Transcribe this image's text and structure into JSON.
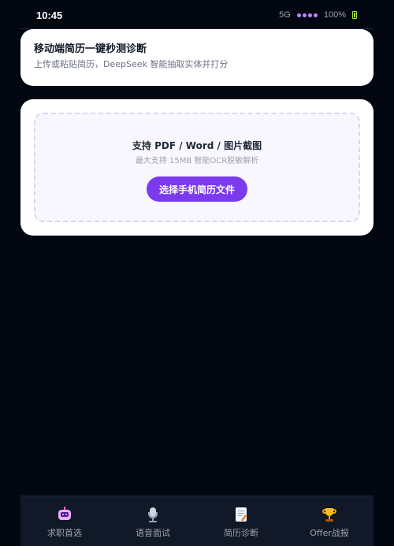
{
  "status_bar": {
    "time": "10:45",
    "network": "5G",
    "battery": "100%"
  },
  "header": {
    "title": "移动端简历一键秒测诊断",
    "subtitle": "上传或粘贴简历，DeepSeek 智能抽取实体并打分"
  },
  "upload": {
    "title": "支持 PDF / Word / 图片截图",
    "hint": "最大支持 15MB 智能OCR脱敏解析",
    "button_label": "选择手机简历文件"
  },
  "bottom_nav": {
    "items": [
      {
        "label": "求职首选",
        "icon": "robot-icon"
      },
      {
        "label": "语音面试",
        "icon": "microphone-icon"
      },
      {
        "label": "简历诊断",
        "icon": "document-icon"
      },
      {
        "label": "Offer战报",
        "icon": "trophy-icon"
      }
    ]
  },
  "colors": {
    "background": "#030712",
    "accent": "#7c3aed",
    "card": "#ffffff",
    "nav_background": "#111827"
  }
}
